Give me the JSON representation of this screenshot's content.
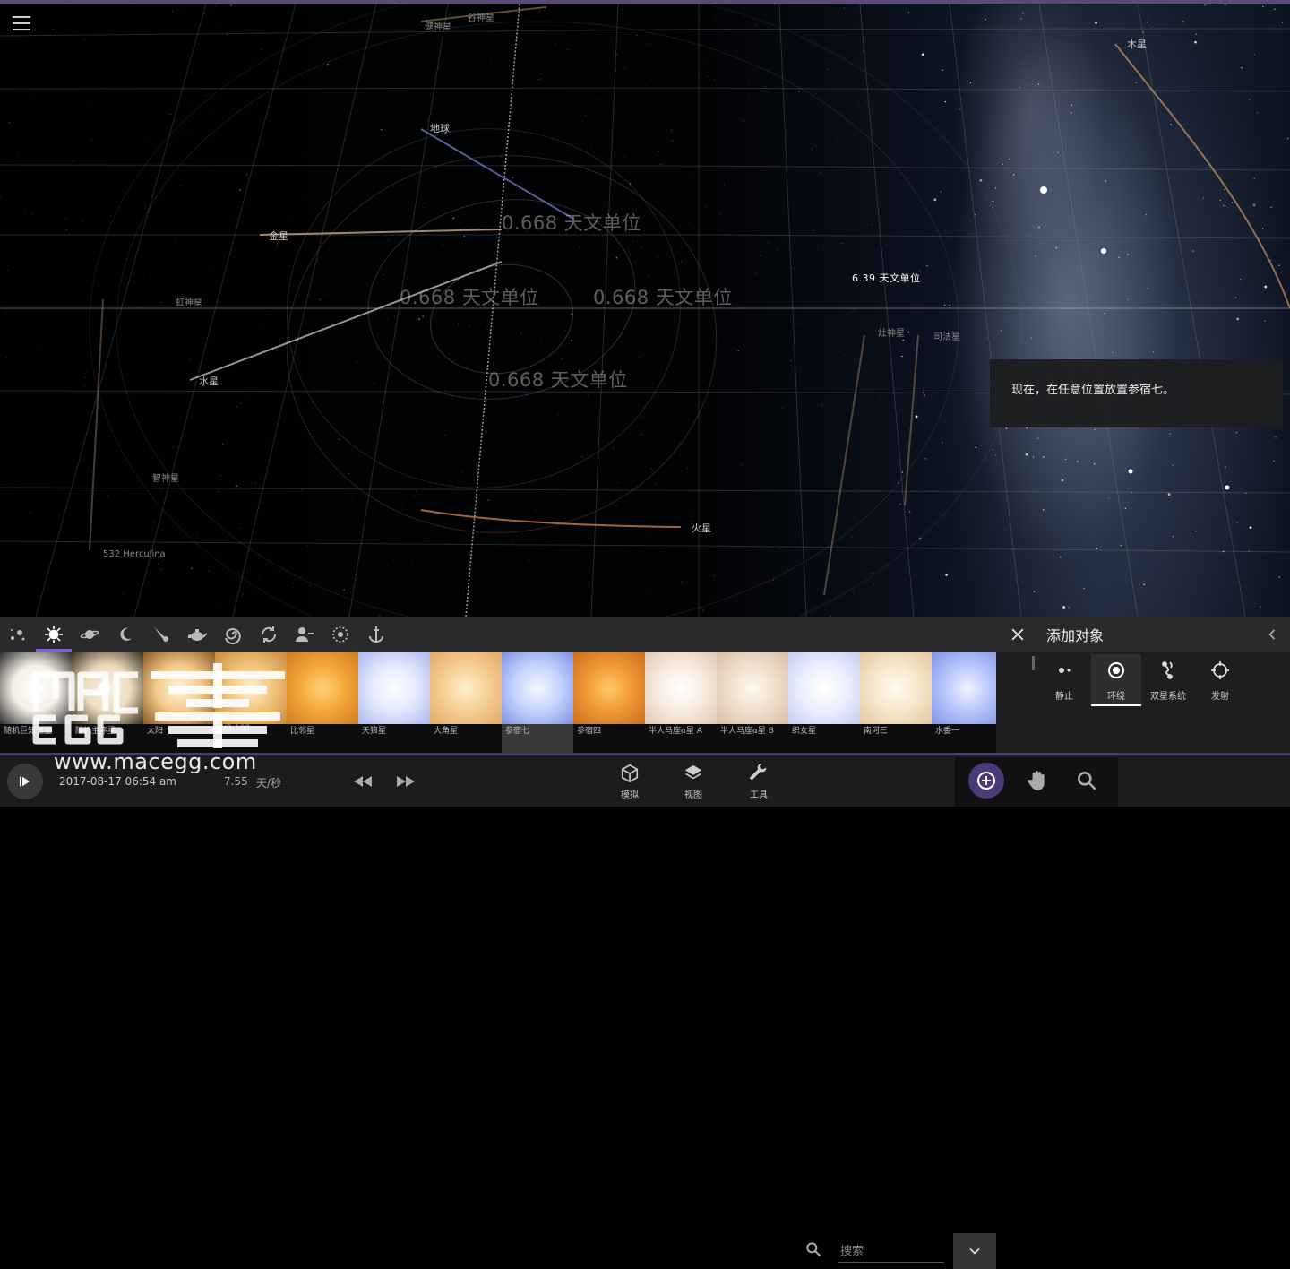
{
  "viewport": {
    "planets": [
      {
        "key": "ceres",
        "label": "谷神星",
        "dim": true
      },
      {
        "key": "vesta",
        "label": "健神星",
        "dim": true
      },
      {
        "key": "earth",
        "label": "地球",
        "dim": false
      },
      {
        "key": "venus",
        "label": "金星",
        "dim": false
      },
      {
        "key": "juno",
        "label": "虹神星",
        "dim": true
      },
      {
        "key": "mercury",
        "label": "水星",
        "dim": false
      },
      {
        "key": "pallas",
        "label": "智神星",
        "dim": true
      },
      {
        "key": "herculina",
        "label": "532 Herculina",
        "dim": true
      },
      {
        "key": "mars",
        "label": "火星",
        "dim": false
      },
      {
        "key": "jupiter",
        "label": "木星",
        "dim": false
      },
      {
        "key": "hestia",
        "label": "灶神星",
        "dim": true
      },
      {
        "key": "themis",
        "label": "司法星",
        "dim": true
      }
    ],
    "distance_labels": {
      "d1": "0.668 天文单位",
      "d2": "0.668 天文单位",
      "d3": "0.668 天文单位",
      "d4": "0.668 天文单位",
      "d5": "6.39 天文单位"
    },
    "hint": "现在，在任意位置放置参宿七。"
  },
  "category_bar": {
    "icons": [
      "galaxy-stars-icon",
      "star-icon",
      "planet-icon",
      "moon-icon",
      "comet-icon",
      "teapot-icon",
      "spiral-galaxy-icon",
      "orbit-swap-icon",
      "character-icon",
      "ring-icon",
      "anchor-icon"
    ],
    "selected_index": 1,
    "search_placeholder": "搜索"
  },
  "add_panel": {
    "title": "添加对象",
    "modes": [
      {
        "key": "static",
        "label": "静止",
        "icon": "static-dot-icon"
      },
      {
        "key": "orbit",
        "label": "环绕",
        "icon": "orbit-target-icon"
      },
      {
        "key": "binary",
        "label": "双星系统",
        "icon": "binary-icon"
      },
      {
        "key": "launch",
        "label": "发射",
        "icon": "crosshair-icon"
      }
    ],
    "selected_mode": "orbit"
  },
  "thumbnails": [
    {
      "label": "随机巨知恒星",
      "colors": [
        "#ffffff",
        "#f5efe6",
        "#2a2a2a"
      ]
    },
    {
      "label": "随机主序星",
      "colors": [
        "#f7f1e4",
        "#eedcbf",
        "#3a3020"
      ]
    },
    {
      "label": "太阳",
      "colors": [
        "#fff6df",
        "#f3c98a",
        "#8a5a25"
      ]
    },
    {
      "label": "WR 102",
      "colors": [
        "#fff2d5",
        "#f2c47c",
        "#c98a3a"
      ]
    },
    {
      "label": "比邻星",
      "colors": [
        "#ffd27a",
        "#f4a63a",
        "#d07a20"
      ]
    },
    {
      "label": "天狼星",
      "colors": [
        "#ffffff",
        "#e4e9ff",
        "#aab7ea"
      ]
    },
    {
      "label": "大角星",
      "colors": [
        "#fff0cf",
        "#f5cf94",
        "#e3a963"
      ]
    },
    {
      "label": "参宿七",
      "colors": [
        "#f4f7ff",
        "#c5d3ff",
        "#7d92df"
      ]
    },
    {
      "label": "参宿四",
      "colors": [
        "#ffc96a",
        "#f09a35",
        "#c86d1c"
      ]
    },
    {
      "label": "半人马座α星 A",
      "colors": [
        "#ffffff",
        "#f7ebe0",
        "#e2c9b3"
      ]
    },
    {
      "label": "半人马座α星 B",
      "colors": [
        "#fff8f0",
        "#f1dfcf",
        "#d9bea4"
      ]
    },
    {
      "label": "织女星",
      "colors": [
        "#ffffff",
        "#ecefff",
        "#c5cdf1"
      ]
    },
    {
      "label": "南河三",
      "colors": [
        "#fffaf0",
        "#f6e7cc",
        "#e4c89d"
      ]
    },
    {
      "label": "水委一",
      "colors": [
        "#f1f4ff",
        "#b8c6fb",
        "#7f93e2"
      ]
    }
  ],
  "selected_thumbnail": 7,
  "bottom_bar": {
    "date": "2017-08-17 06:54 am",
    "speed_value": "7.55",
    "speed_unit": "天/秒",
    "nav": [
      {
        "key": "simulate",
        "label": "模拟",
        "icon": "cube-icon"
      },
      {
        "key": "view",
        "label": "视图",
        "icon": "layers-icon"
      },
      {
        "key": "tools",
        "label": "工具",
        "icon": "wrench-icon"
      }
    ]
  },
  "watermark": {
    "brand": "MAC EGG 麦蛋",
    "url": "www.macegg.com"
  },
  "colors": {
    "accent": "#7b5fc4",
    "panel": "#2a2a2c",
    "bottom": "#1c1c1e"
  }
}
